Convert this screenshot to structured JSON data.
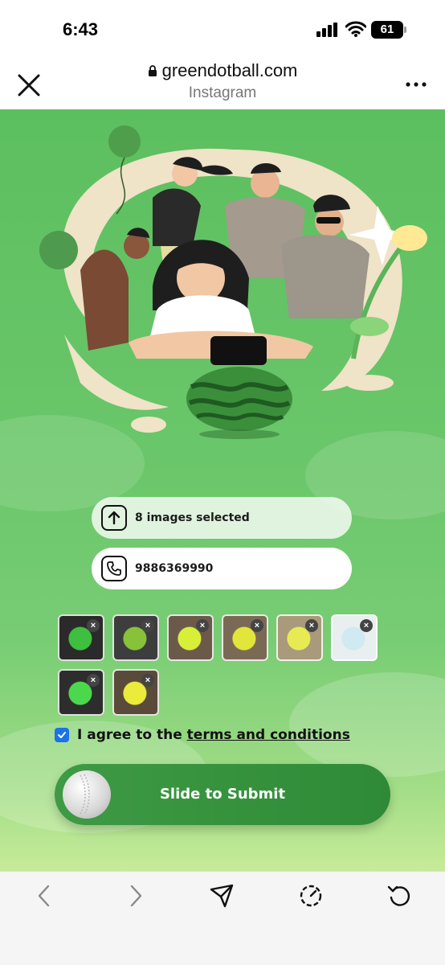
{
  "status_bar": {
    "time": "6:43",
    "battery": "61",
    "icons": [
      "cellular-signal-icon",
      "wifi-icon",
      "battery-icon"
    ]
  },
  "browser": {
    "url": "greendotball.com",
    "subtitle": "Instagram",
    "icons": [
      "close-icon",
      "lock-icon",
      "more-icon"
    ]
  },
  "form": {
    "upload_text": "8 images selected",
    "phone_value": "9886369990",
    "thumbnails": [
      {
        "ball_color": "#3fbf3f",
        "bg": "#2a2a2a"
      },
      {
        "ball_color": "#88c23a",
        "bg": "#3d3d3d"
      },
      {
        "ball_color": "#d8ef3a",
        "bg": "#6b5a4a"
      },
      {
        "ball_color": "#e2e63a",
        "bg": "#7a6a55"
      },
      {
        "ball_color": "#e8ea54",
        "bg": "#a89a7a"
      },
      {
        "ball_color": "#cfeaf0",
        "bg": "#e9eef0"
      },
      {
        "ball_color": "#4cd84c",
        "bg": "#2d2d2d"
      },
      {
        "ball_color": "#eaeb3a",
        "bg": "#5a4a3a"
      }
    ],
    "agree_prefix": "I agree to the ",
    "agree_link": "terms and conditions",
    "agree_checked": true,
    "submit_label": "Slide to Submit"
  },
  "toolbar": {
    "icons": [
      "back-icon",
      "forward-icon",
      "share-icon",
      "speed-icon",
      "refresh-icon"
    ]
  },
  "colors": {
    "accent": "#3f9a45",
    "checkbox": "#1a73e8"
  }
}
